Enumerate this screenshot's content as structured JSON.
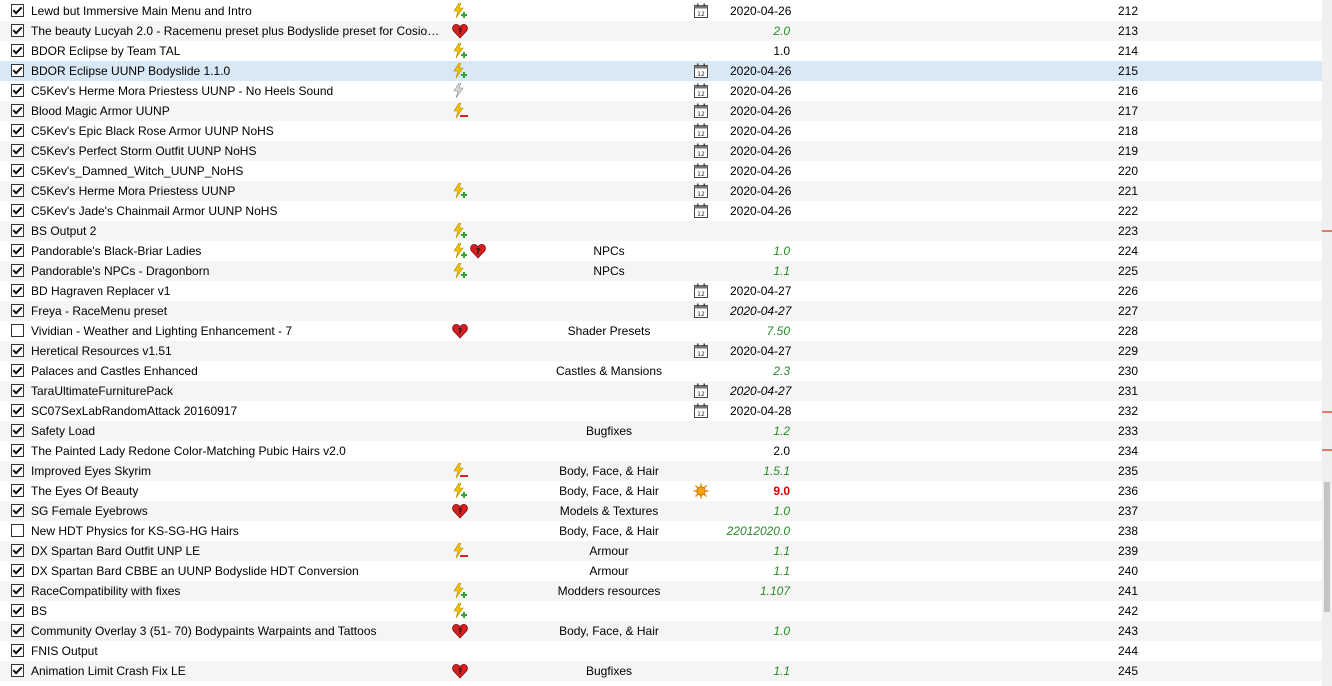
{
  "colors": {
    "green_version": "#2a8a2a",
    "red_version": "#d40000",
    "selected_row": "#d9e8f5"
  },
  "rows": [
    {
      "checked": true,
      "name": "Lewd but Immersive Main Menu and Intro",
      "flags": [
        "plugin-plus-icon"
      ],
      "category": "",
      "contents": [
        "calendar-icon"
      ],
      "version": "2020-04-26",
      "vstyle": "date",
      "priority": "212"
    },
    {
      "checked": true,
      "name": "The beauty Lucyah 2.0 - Racemenu preset plus Bodyslide preset for CosioHD...",
      "flags": [
        "heart-question-icon"
      ],
      "category": "",
      "contents": [],
      "version": "2.0",
      "vstyle": "green",
      "priority": "213"
    },
    {
      "checked": true,
      "name": "BDOR Eclipse by Team TAL",
      "flags": [
        "plugin-plus-icon"
      ],
      "category": "",
      "contents": [],
      "version": "1.0",
      "vstyle": "plain",
      "priority": "214"
    },
    {
      "checked": true,
      "name": "BDOR Eclipse UUNP Bodyslide 1.1.0",
      "flags": [
        "plugin-plus-icon"
      ],
      "category": "",
      "contents": [
        "calendar-icon"
      ],
      "version": "2020-04-26",
      "vstyle": "date",
      "priority": "215",
      "selected": true
    },
    {
      "checked": true,
      "name": "C5Kev's Herme Mora Priestess UUNP - No Heels Sound",
      "flags": [
        "plugin-grey-icon"
      ],
      "category": "",
      "contents": [
        "calendar-icon"
      ],
      "version": "2020-04-26",
      "vstyle": "date",
      "priority": "216"
    },
    {
      "checked": true,
      "name": "Blood Magic Armor UUNP",
      "flags": [
        "plugin-minus-icon"
      ],
      "category": "",
      "contents": [
        "calendar-icon"
      ],
      "version": "2020-04-26",
      "vstyle": "date",
      "priority": "217"
    },
    {
      "checked": true,
      "name": "C5Kev's Epic Black Rose Armor UUNP NoHS",
      "flags": [],
      "category": "",
      "contents": [
        "calendar-icon"
      ],
      "version": "2020-04-26",
      "vstyle": "date",
      "priority": "218"
    },
    {
      "checked": true,
      "name": "C5Kev's Perfect Storm Outfit UUNP NoHS",
      "flags": [],
      "category": "",
      "contents": [
        "calendar-icon"
      ],
      "version": "2020-04-26",
      "vstyle": "date",
      "priority": "219"
    },
    {
      "checked": true,
      "name": "C5Kev's_Damned_Witch_UUNP_NoHS",
      "flags": [],
      "category": "",
      "contents": [
        "calendar-icon"
      ],
      "version": "2020-04-26",
      "vstyle": "date",
      "priority": "220"
    },
    {
      "checked": true,
      "name": "C5Kev's Herme Mora Priestess UUNP",
      "flags": [
        "plugin-plus-icon"
      ],
      "category": "",
      "contents": [
        "calendar-icon"
      ],
      "version": "2020-04-26",
      "vstyle": "date",
      "priority": "221"
    },
    {
      "checked": true,
      "name": "C5Kev's Jade's Chainmail Armor UUNP NoHS",
      "flags": [],
      "category": "",
      "contents": [
        "calendar-icon"
      ],
      "version": "2020-04-26",
      "vstyle": "date",
      "priority": "222"
    },
    {
      "checked": true,
      "name": "BS Output 2",
      "flags": [
        "plugin-plus-icon"
      ],
      "category": "",
      "contents": [],
      "version": "",
      "vstyle": "plain",
      "priority": "223"
    },
    {
      "checked": true,
      "name": "Pandorable's Black-Briar Ladies",
      "flags": [
        "plugin-plus-icon",
        "heart-question-icon"
      ],
      "category": "NPCs",
      "contents": [],
      "version": "1.0",
      "vstyle": "green",
      "priority": "224"
    },
    {
      "checked": true,
      "name": "Pandorable's NPCs - Dragonborn",
      "flags": [
        "plugin-plus-icon"
      ],
      "category": "NPCs",
      "contents": [],
      "version": "1.1",
      "vstyle": "green",
      "priority": "225"
    },
    {
      "checked": true,
      "name": "BD Hagraven Replacer v1",
      "flags": [],
      "category": "",
      "contents": [
        "calendar-icon"
      ],
      "version": "2020-04-27",
      "vstyle": "date",
      "priority": "226"
    },
    {
      "checked": true,
      "name": "Freya - RaceMenu preset",
      "flags": [],
      "category": "",
      "contents": [
        "calendar-icon"
      ],
      "version": "2020-04-27",
      "vstyle": "date-italic",
      "priority": "227"
    },
    {
      "checked": false,
      "name": "Vividian - Weather and Lighting Enhancement - 7",
      "flags": [
        "heart-question-icon"
      ],
      "category": "Shader Presets",
      "contents": [],
      "version": "7.50",
      "vstyle": "green",
      "priority": "228"
    },
    {
      "checked": true,
      "name": "Heretical Resources v1.51",
      "flags": [],
      "category": "",
      "contents": [
        "calendar-icon"
      ],
      "version": "2020-04-27",
      "vstyle": "date",
      "priority": "229"
    },
    {
      "checked": true,
      "name": "Palaces and Castles Enhanced",
      "flags": [],
      "category": "Castles & Mansions",
      "contents": [],
      "version": "2.3",
      "vstyle": "green",
      "priority": "230"
    },
    {
      "checked": true,
      "name": "TaraUltimateFurniturePack",
      "flags": [],
      "category": "",
      "contents": [
        "calendar-icon"
      ],
      "version": "2020-04-27",
      "vstyle": "date-italic",
      "priority": "231"
    },
    {
      "checked": true,
      "name": "SC07SexLabRandomAttack 20160917",
      "flags": [],
      "category": "",
      "contents": [
        "calendar-icon"
      ],
      "version": "2020-04-28",
      "vstyle": "date",
      "priority": "232"
    },
    {
      "checked": true,
      "name": "Safety Load",
      "flags": [],
      "category": "Bugfixes",
      "contents": [],
      "version": "1.2",
      "vstyle": "green",
      "priority": "233"
    },
    {
      "checked": true,
      "name": "The Painted Lady Redone Color-Matching Pubic Hairs v2.0",
      "flags": [],
      "category": "",
      "contents": [],
      "version": "2.0",
      "vstyle": "plain",
      "priority": "234"
    },
    {
      "checked": true,
      "name": "Improved Eyes Skyrim",
      "flags": [
        "plugin-minus-icon"
      ],
      "category": "Body, Face, & Hair",
      "contents": [],
      "version": "1.5.1",
      "vstyle": "green",
      "priority": "235"
    },
    {
      "checked": true,
      "name": "The Eyes Of Beauty",
      "flags": [
        "plugin-plus-icon"
      ],
      "category": "Body, Face, & Hair",
      "contents": [
        "sun-icon"
      ],
      "version": "9.0",
      "vstyle": "red",
      "priority": "236"
    },
    {
      "checked": true,
      "name": "SG Female Eyebrows",
      "flags": [
        "heart-question-icon"
      ],
      "category": "Models & Textures",
      "contents": [],
      "version": "1.0",
      "vstyle": "green",
      "priority": "237"
    },
    {
      "checked": false,
      "name": "New HDT Physics for KS-SG-HG Hairs",
      "flags": [],
      "category": "Body, Face, & Hair",
      "contents": [],
      "version": "22012020.0",
      "vstyle": "green",
      "priority": "238"
    },
    {
      "checked": true,
      "name": "DX Spartan Bard Outfit UNP LE",
      "flags": [
        "plugin-minus-icon"
      ],
      "category": "Armour",
      "contents": [],
      "version": "1.1",
      "vstyle": "green",
      "priority": "239"
    },
    {
      "checked": true,
      "name": "DX Spartan Bard CBBE an UUNP Bodyslide HDT Conversion",
      "flags": [],
      "category": "Armour",
      "contents": [],
      "version": "1.1",
      "vstyle": "green",
      "priority": "240"
    },
    {
      "checked": true,
      "name": "RaceCompatibility with fixes",
      "flags": [
        "plugin-plus-icon"
      ],
      "category": "Modders resources",
      "contents": [],
      "version": "1.107",
      "vstyle": "green",
      "priority": "241"
    },
    {
      "checked": true,
      "name": "BS",
      "flags": [
        "plugin-plus-icon"
      ],
      "category": "",
      "contents": [],
      "version": "",
      "vstyle": "plain",
      "priority": "242"
    },
    {
      "checked": true,
      "name": "Community Overlay 3 (51- 70) Bodypaints Warpaints and Tattoos",
      "flags": [
        "heart-question-icon"
      ],
      "category": "Body, Face, & Hair",
      "contents": [],
      "version": "1.0",
      "vstyle": "green",
      "priority": "243"
    },
    {
      "checked": true,
      "name": "FNIS Output",
      "flags": [],
      "category": "",
      "contents": [],
      "version": "",
      "vstyle": "plain",
      "priority": "244"
    },
    {
      "checked": true,
      "name": "Animation Limit Crash Fix LE",
      "flags": [
        "heart-question-icon"
      ],
      "category": "Bugfixes",
      "contents": [],
      "version": "1.1",
      "vstyle": "green",
      "priority": "245"
    }
  ]
}
